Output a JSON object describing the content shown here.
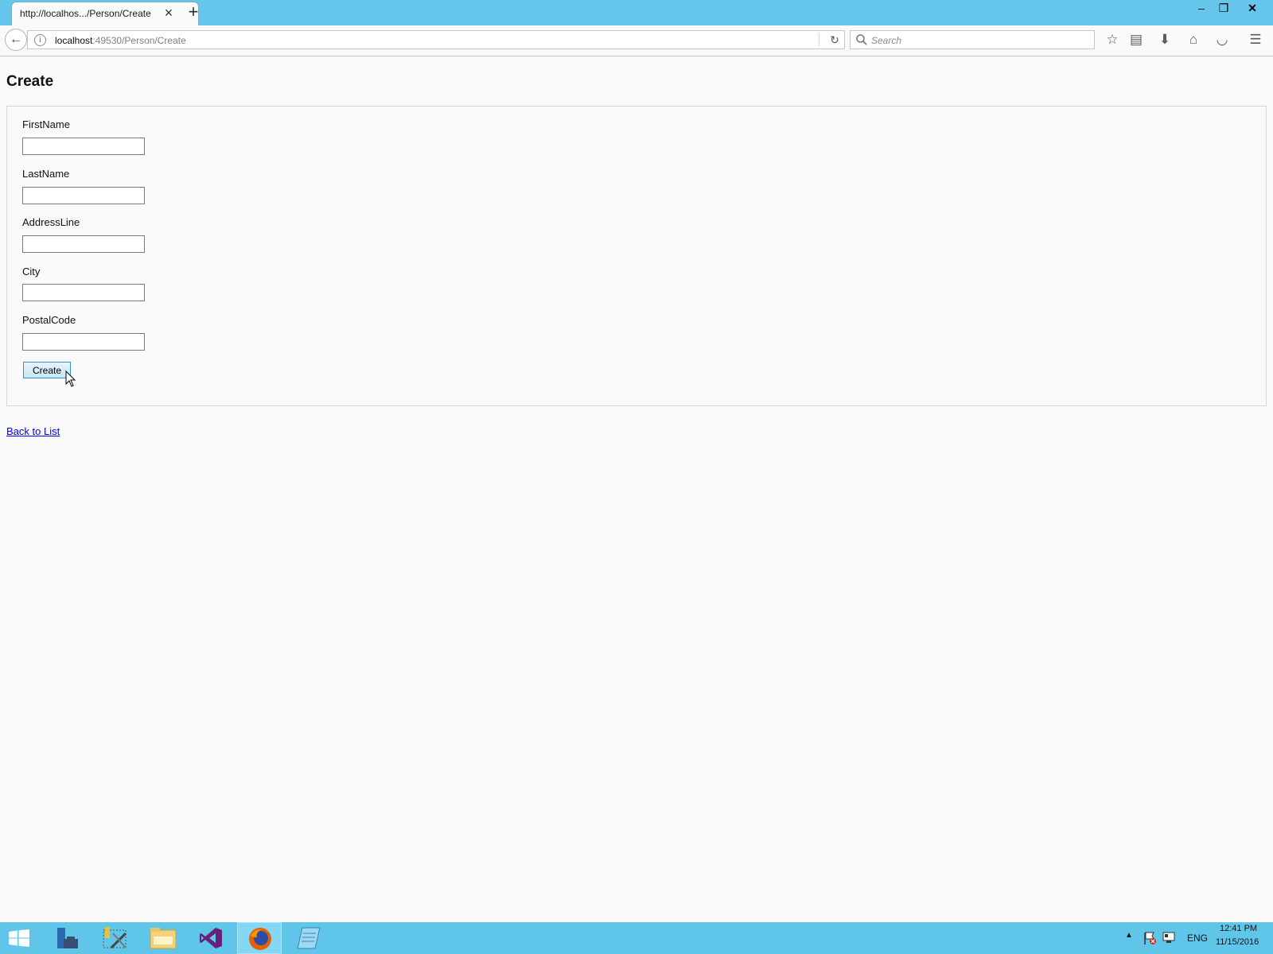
{
  "browser": {
    "tab_title": "http://localhos.../Person/Create",
    "url_host": "localhost",
    "url_rest": ":49530/Person/Create",
    "search_placeholder": "Search"
  },
  "page": {
    "title": "Create",
    "fields": [
      {
        "label": "FirstName",
        "value": ""
      },
      {
        "label": "LastName",
        "value": ""
      },
      {
        "label": "AddressLine",
        "value": ""
      },
      {
        "label": "City",
        "value": ""
      },
      {
        "label": "PostalCode",
        "value": ""
      }
    ],
    "submit_label": "Create",
    "back_link": "Back to List"
  },
  "taskbar": {
    "language": "ENG",
    "time": "12:41 PM",
    "date": "11/15/2016"
  },
  "colors": {
    "titlebar": "#65c5ea",
    "taskbar": "#5fc6ea",
    "link": "#0000ee"
  }
}
